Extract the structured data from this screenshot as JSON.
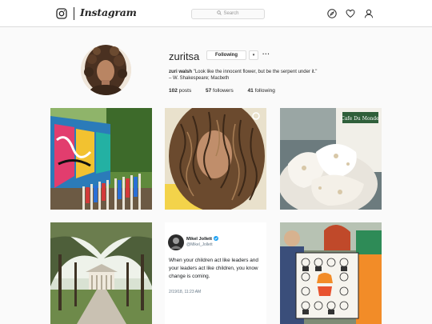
{
  "header": {
    "wordmark": "Instagram",
    "search_placeholder": "Search",
    "icons": [
      "instagram-camera-icon",
      "compass-icon",
      "heart-icon",
      "person-icon"
    ]
  },
  "profile": {
    "username": "zuritsa",
    "following_label": "Following",
    "dropdown_glyph": "▾",
    "more_glyph": "···",
    "bio_name": "zuri walsh",
    "bio_quote": " \"Look like the innocent flower, but be the serpent under it.\"",
    "bio_attribution": "– W. Shakespeare; Macbeth",
    "posts_count": "102",
    "posts_label": " posts",
    "followers_count": "57",
    "followers_label": " followers",
    "following_count": "41",
    "following_label_stat": " following"
  },
  "tweet": {
    "name": "Mikel Jollett",
    "handle": "@Mikel_Jollett",
    "text": "When your children act like leaders and your leaders act like children, you know change is coming.",
    "date": "2/19/18, 11:23 AM",
    "verified_color": "#1da1f2"
  },
  "posts": [
    {
      "subject": "graffiti-fence-art"
    },
    {
      "subject": "curly-hair-selfie"
    },
    {
      "subject": "cafe-du-monde-beignets",
      "cup_text": "Cafe Du Monde"
    },
    {
      "subject": "oak-alley-plantation"
    },
    {
      "subject": "tweet-screenshot"
    },
    {
      "subject": "protest-sign-portraits"
    }
  ],
  "colors": {
    "border": "#dbdbdb",
    "background": "#fafafa",
    "text": "#262626"
  }
}
